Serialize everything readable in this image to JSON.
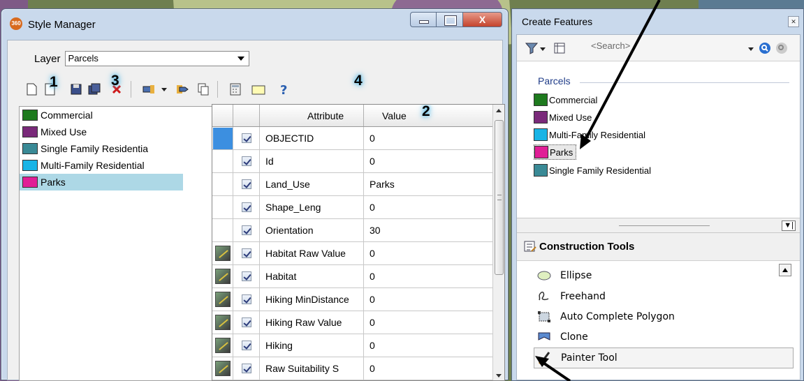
{
  "style_manager": {
    "title": "Style Manager",
    "app_badge": "360",
    "close_glyph": "X",
    "layer_label": "Layer",
    "layer_value": "Parcels",
    "callouts": [
      "1",
      "3",
      "4",
      "2"
    ],
    "classes": [
      {
        "label": "Commercial",
        "color": "#1e7a1e"
      },
      {
        "label": "Mixed Use",
        "color": "#7a2a7a"
      },
      {
        "label": "Single Family Residentia",
        "color": "#3a8a96"
      },
      {
        "label": "Multi-Family Residential",
        "color": "#18b4e6"
      },
      {
        "label": "Parks",
        "color": "#e01e96",
        "selected": true
      }
    ],
    "grid": {
      "headers": {
        "attribute": "Attribute",
        "value": "Value"
      },
      "rows": [
        {
          "attribute": "OBJECTID",
          "value": "0"
        },
        {
          "attribute": "Id",
          "value": "0"
        },
        {
          "attribute": "Land_Use",
          "value": "Parks"
        },
        {
          "attribute": "Shape_Leng",
          "value": "0"
        },
        {
          "attribute": "Orientation",
          "value": "30"
        },
        {
          "attribute": "Habitat Raw Value",
          "value": "0"
        },
        {
          "attribute": "Habitat",
          "value": "0"
        },
        {
          "attribute": "Hiking MinDistance",
          "value": "0"
        },
        {
          "attribute": "Hiking Raw Value",
          "value": "0"
        },
        {
          "attribute": "Hiking",
          "value": "0"
        },
        {
          "attribute": "Raw Suitability S",
          "value": "0"
        }
      ]
    }
  },
  "create_features": {
    "title": "Create Features",
    "search_placeholder": "<Search>",
    "group": "Parcels",
    "templates": [
      {
        "label": "Commercial",
        "color": "#1e7a1e"
      },
      {
        "label": "Mixed Use",
        "color": "#7a2a7a"
      },
      {
        "label": "Multi-Family Residential",
        "color": "#18b4e6"
      },
      {
        "label": "Parks",
        "color": "#e01e96",
        "selected": true
      },
      {
        "label": "Single Family Residential",
        "color": "#3a8a96"
      }
    ],
    "construction_tools_header": "Construction Tools",
    "tools": [
      {
        "label": "Ellipse",
        "icon": "ellipse-icon"
      },
      {
        "label": "Freehand",
        "icon": "freehand-icon"
      },
      {
        "label": "Auto Complete Polygon",
        "icon": "auto-complete-polygon-icon"
      },
      {
        "label": "Clone",
        "icon": "clone-icon"
      },
      {
        "label": "Painter Tool",
        "icon": "painter-icon",
        "selected": true
      }
    ]
  }
}
